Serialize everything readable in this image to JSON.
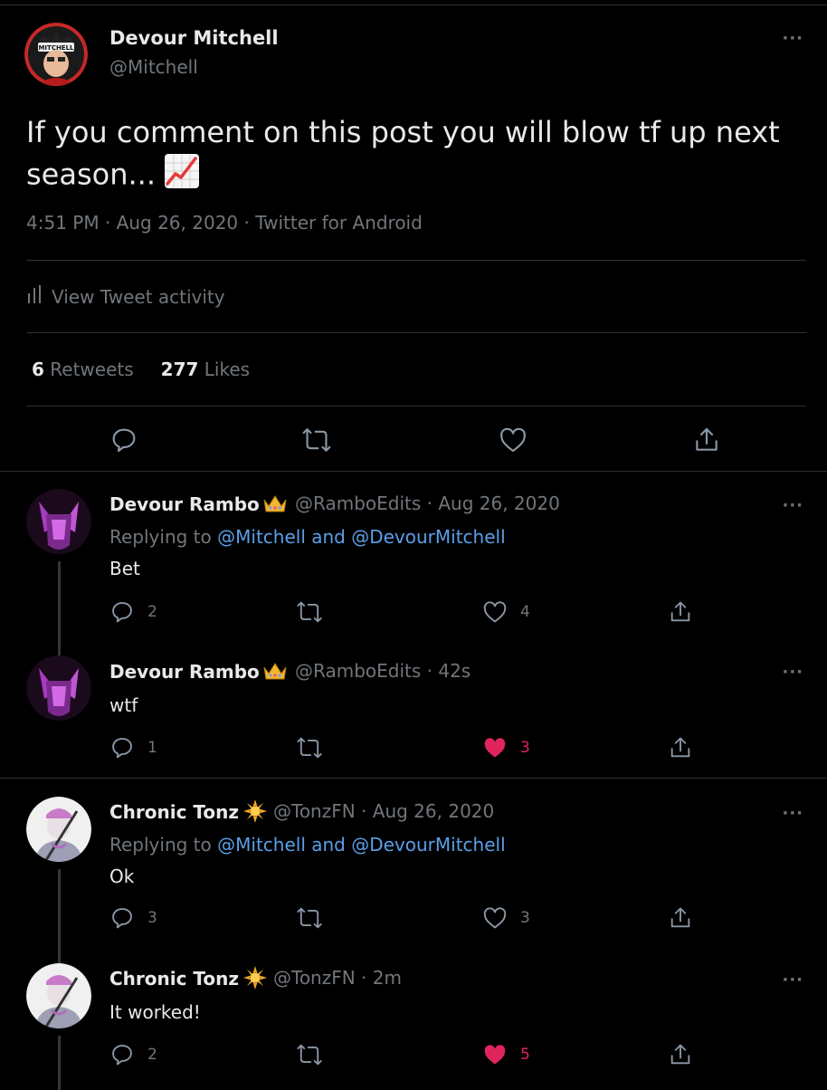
{
  "main_tweet": {
    "author_name": "Devour Mitchell",
    "author_handle": "@Mitchell",
    "avatar_label": "MITCHELL",
    "text": "If you comment on this post you will blow tf up next season...",
    "emoji": "chart-increasing-icon",
    "time": "4:51 PM",
    "date": "Aug 26, 2020",
    "source": "Twitter for Android",
    "meta_sep": " · ",
    "activity_label": "View Tweet activity",
    "retweets_count": "6",
    "retweets_label": "Retweets",
    "likes_count": "277",
    "likes_label": "Likes",
    "more": "···"
  },
  "replies": [
    {
      "name": "Devour Rambo",
      "badge": "crown-icon",
      "handle": "@RamboEdits · Aug 26, 2020",
      "replying_prefix": "Replying to",
      "replying_to": "@Mitchell and @DevourMitchell",
      "text": "Bet",
      "reply_count": "2",
      "retweet_count": "",
      "like_count": "4",
      "liked": false
    },
    {
      "name": "Devour Rambo",
      "badge": "crown-icon",
      "handle": "@RamboEdits · 42s",
      "text": "wtf",
      "reply_count": "1",
      "retweet_count": "",
      "like_count": "3",
      "liked": true
    },
    {
      "name": "Chronic Tonz",
      "badge": "sun-icon",
      "handle": "@TonzFN · Aug 26, 2020",
      "replying_prefix": "Replying to",
      "replying_to": "@Mitchell and @DevourMitchell",
      "text": "Ok",
      "reply_count": "3",
      "retweet_count": "",
      "like_count": "3",
      "liked": false
    },
    {
      "name": "Chronic Tonz",
      "badge": "sun-icon",
      "handle": "@TonzFN · 2m",
      "text": "It worked!",
      "reply_count": "2",
      "retweet_count": "",
      "like_count": "5",
      "liked": true
    }
  ],
  "colors": {
    "background": "#000000",
    "link": "#5b9fe8",
    "muted": "#71767b",
    "like": "#e0245e"
  }
}
